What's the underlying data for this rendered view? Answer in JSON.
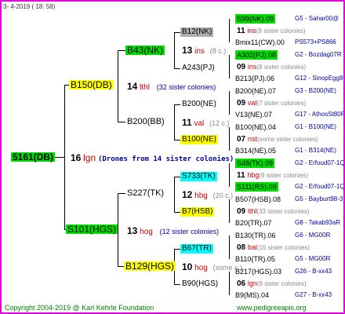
{
  "timestamp": "3-  4-2019 ( 18:  58)",
  "root": "5161(DB)",
  "drones": {
    "num": "16",
    "line": "lgn",
    "text": "(Drones from 14 sister colonies)"
  },
  "p1": "B150(DB)",
  "p2": "S101(HGS)",
  "p1_mid": {
    "num": "14",
    "line": "lthl",
    "text": "(32 sister colonies)"
  },
  "p2_mid": {
    "num": "13",
    "line": "hog",
    "text": "(12 sister colonies)"
  },
  "g1": "B43(NK)",
  "g2": "B200(BB)",
  "g3": "S227(TK)",
  "g4": "B129(HGS)",
  "g1_mid": {
    "num": "13",
    "line": "ins",
    "text": "(8 c.)"
  },
  "g2_mid": {
    "num": "11",
    "line": "val",
    "text": "(12 c.)"
  },
  "g3_mid": {
    "num": "12",
    "line": "hbg",
    "text": "(20 c.)"
  },
  "g4_mid": {
    "num": "10",
    "line": "hog",
    "text": "(some c.)"
  },
  "gg": [
    "B12(NK)",
    "A243(PJ)",
    "B200(NE)",
    "B100(NE)",
    "S733(TK)",
    "B7(HSB)",
    "B67(TR)",
    "B90(HGS)"
  ],
  "right": [
    {
      "top": "S99(NK).09",
      "topr": "G5 - Sahar00@",
      "mid_num": "11",
      "mid_line": "ins",
      "mid_text": "(8 sister colonies)",
      "bot": "Bmix11(CW).00",
      "botr": "PS573+PS866"
    },
    {
      "top": "A302(PJ).08",
      "topr": "G2 - Bozdag07R",
      "mid_num": "09",
      "mid_line": "ins",
      "mid_text": "(8 sister colonies)",
      "bot": "B213(PJ).06",
      "botr": "G12 - SinopEgg86R"
    },
    {
      "top": "B200(NE).07",
      "topr": "G3 - B200(NE)",
      "mid_num": "09",
      "mid_line": "val",
      "mid_text": "(7 sister colonies)",
      "bot": "V13(NE).07",
      "botr": "G17 - AthosSt80R"
    },
    {
      "top": "B100(NE).04",
      "topr": "G1 - B100(NE)",
      "mid_num": "07",
      "mid_line": "nst",
      "mid_text": "(some sister colonies)",
      "bot": "B314(NE).05",
      "botr": "G1 - B314(NE)"
    },
    {
      "top": "S48(TK).09",
      "topr": "G2 - Erfoud07-1Q",
      "mid_num": "11",
      "mid_line": "hbg",
      "mid_text": "(8 sister colonies)",
      "bot": "S111(RS).09",
      "botr": "G2 - Erfoud07-1Q"
    },
    {
      "top": "B507(HSB).08",
      "topr": "G5 - Bayburt98-3",
      "mid_num": "09",
      "mid_line": "lthl",
      "mid_text": "(33 sister colonies)",
      "bot": "B20(TR).07",
      "botr": "G8 - Takab93aR"
    },
    {
      "top": "B130(TR).06",
      "topr": "G6 - MG00R",
      "mid_num": "08",
      "mid_line": "bal",
      "mid_text": "(15 sister colonies)",
      "bot": "B110(TR).05",
      "botr": "G5 - MG00R"
    },
    {
      "top": "B217(HGS).03",
      "topr": "G26 - B-xx43",
      "mid_num": "06",
      "mid_line": "lgn",
      "mid_text": "(8 sister colonies)",
      "bot": "B9(MS).04",
      "botr": "G27 - B-xx43"
    }
  ],
  "footer": {
    "copyright": "Copyright 2004-2019 @ Karl Kehrle Foundation",
    "site": "www.pedigreeapis.org"
  }
}
